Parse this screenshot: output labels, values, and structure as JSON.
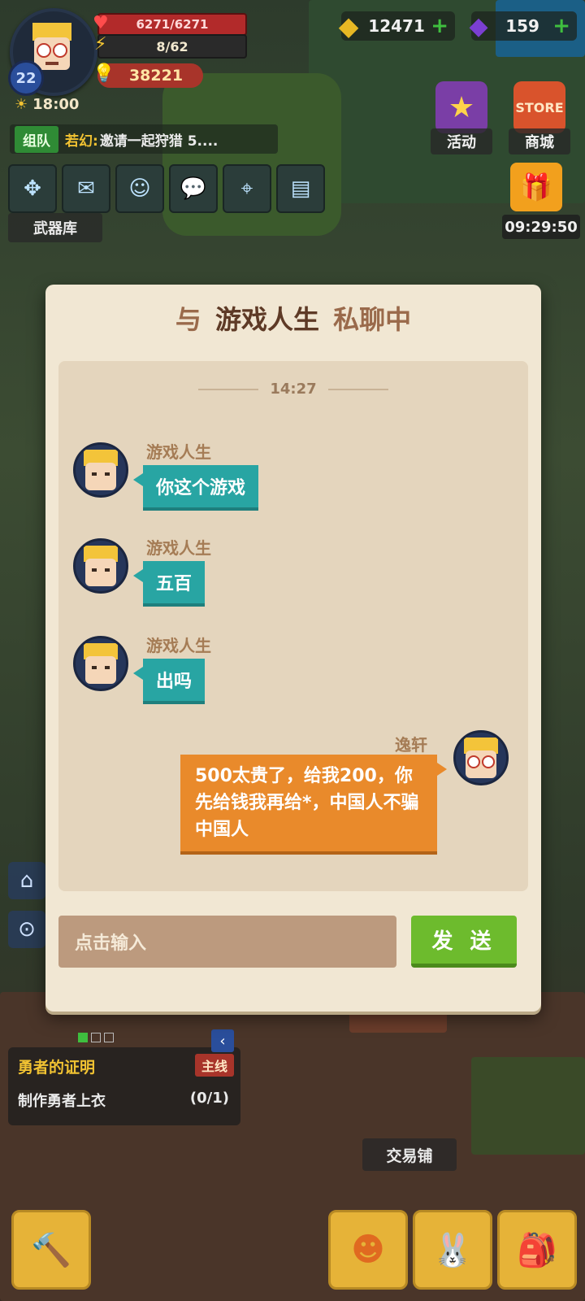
{
  "hud": {
    "level": "22",
    "hp": "6271/6271",
    "energy": "8/62",
    "power": "38221",
    "time": "18:00"
  },
  "currency": {
    "gold": "12471",
    "gems": "159"
  },
  "team": {
    "tag": "组队",
    "name": "若幻:",
    "message": "邀请一起狩猎 5...."
  },
  "armory_label": "武器库",
  "side_buttons": {
    "activity": "活动",
    "store": "商城",
    "store_sign": "STORE",
    "gift_timer": "09:29:50"
  },
  "chat": {
    "title_prefix": "与",
    "partner": "游戏人生",
    "title_suffix": "私聊中",
    "timestamp": "14:27",
    "messages": [
      {
        "sender": "游戏人生",
        "text": "你这个游戏"
      },
      {
        "sender": "游戏人生",
        "text": "五百"
      },
      {
        "sender": "游戏人生",
        "text": "出吗"
      },
      {
        "sender": "逸轩",
        "text": "500太贵了，给我200，你先给钱我再给*，中国人不骗中国人"
      }
    ],
    "input_placeholder": "点击输入",
    "send_label": "发 送"
  },
  "quest": {
    "title": "勇者的证明",
    "tag": "主线",
    "task": "制作勇者上衣",
    "progress": "(0/1)"
  },
  "trade_label": "交易铺",
  "colors": {
    "teal_bubble": "#28a5a3",
    "orange_bubble": "#e98a2b",
    "send_green": "#6dbb2d",
    "panel_bg": "#f1e7d3"
  }
}
